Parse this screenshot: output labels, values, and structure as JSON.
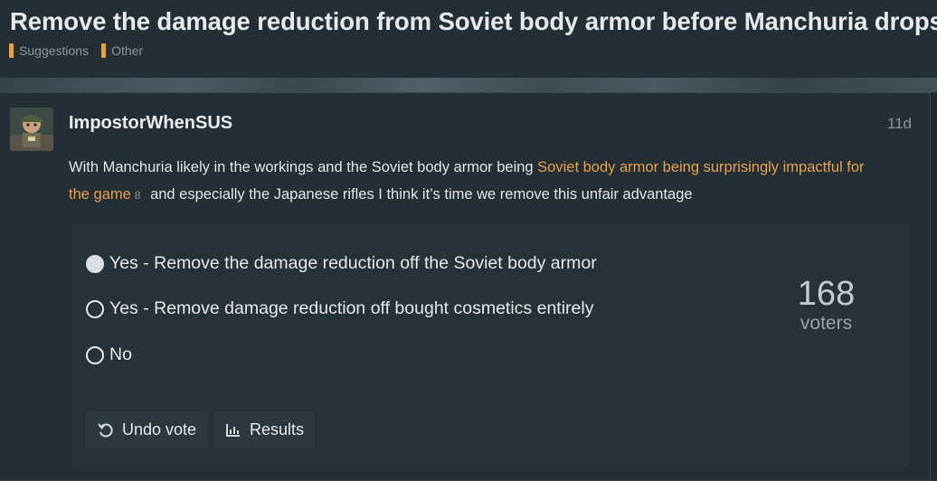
{
  "topic": {
    "title": "Remove the damage reduction from Soviet body armor before Manchuria drops",
    "tags": [
      {
        "label": "Suggestions",
        "color": "#f0a030"
      },
      {
        "label": "Other",
        "color": "#f0a030"
      }
    ]
  },
  "post": {
    "username": "ImpostorWhenSUS",
    "date": "11d",
    "body_before": "With Manchuria likely in the workings and the Soviet body armor being ",
    "link_text": "Soviet body armor being surprisingly impactful for the game",
    "link_clicks": "8",
    "body_after": " and especially the Japanese rifles I think it’s time we remove this unfair advantage"
  },
  "poll": {
    "options": [
      {
        "label": "Yes - Remove the damage reduction off the Soviet body armor",
        "selected": true
      },
      {
        "label": "Yes - Remove damage reduction off bought cosmetics entirely",
        "selected": false
      },
      {
        "label": "No",
        "selected": false
      }
    ],
    "voter_count": "168",
    "voters_label": "voters",
    "undo_label": "Undo vote",
    "results_label": "Results"
  },
  "colors": {
    "accent": "#e8a14b",
    "background": "#202b31"
  }
}
